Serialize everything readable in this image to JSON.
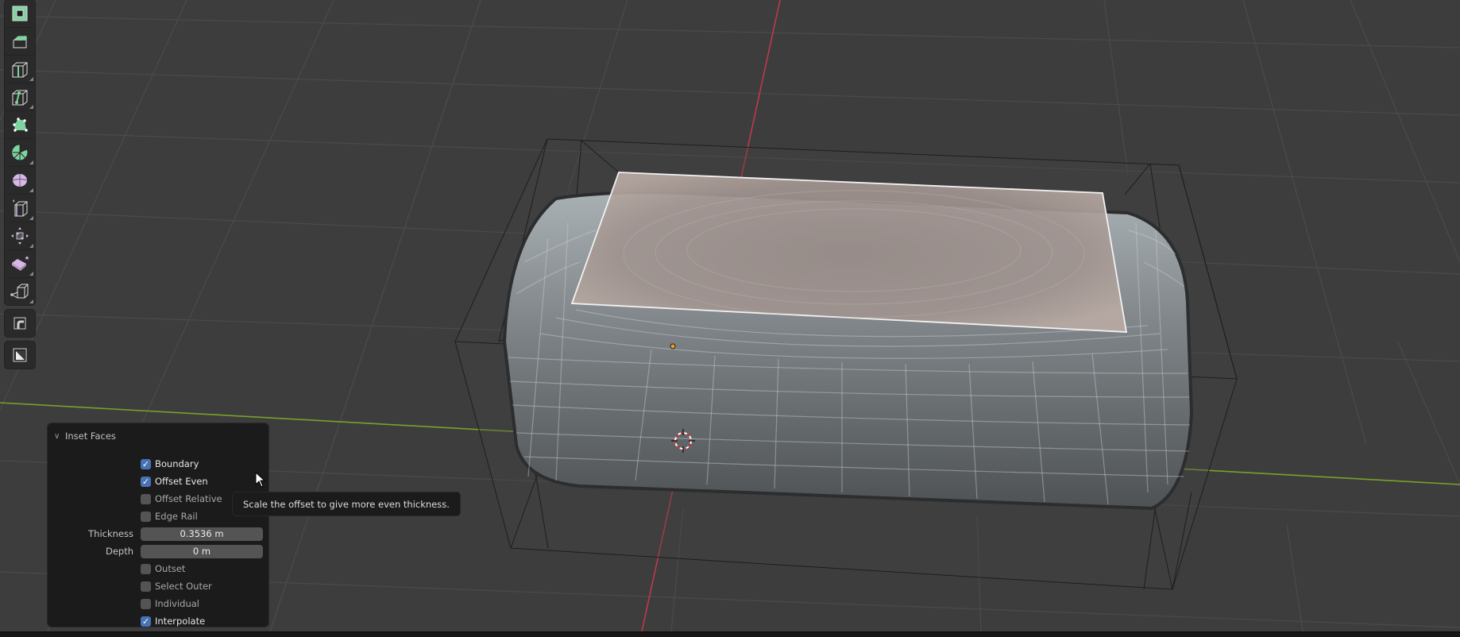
{
  "app": "Blender",
  "viewport": {
    "mode": "Edit Mode",
    "background_color": "#3d3d3d",
    "axis_colors": {
      "x": "#c0394b",
      "y": "#7aa02a"
    },
    "selected_face_color": "#b59e94",
    "origin_color": "#f09a20"
  },
  "toolbar": {
    "groups": [
      [
        {
          "icon": "select-box-icon",
          "label": "Select Box",
          "active": true
        },
        {
          "icon": "extrude-region-icon",
          "label": "Extrude Region"
        },
        {
          "icon": "loop-cut-icon",
          "label": "Loop Cut"
        },
        {
          "icon": "knife-icon",
          "label": "Knife"
        },
        {
          "icon": "poly-build-icon",
          "label": "Poly Build"
        },
        {
          "icon": "spin-icon",
          "label": "Spin"
        },
        {
          "icon": "smooth-icon",
          "label": "Smooth"
        },
        {
          "icon": "edge-slide-icon",
          "label": "Edge Slide"
        },
        {
          "icon": "shrink-fatten-icon",
          "label": "Shrink/Fatten"
        },
        {
          "icon": "shear-icon",
          "label": "Shear"
        },
        {
          "icon": "rip-region-icon",
          "label": "Rip Region"
        }
      ],
      [
        {
          "icon": "annotate-icon",
          "label": "Annotate"
        }
      ],
      [
        {
          "icon": "measure-icon",
          "label": "Measure"
        }
      ]
    ]
  },
  "operator_panel": {
    "title": "Inset Faces",
    "options": [
      {
        "label": "Boundary",
        "checked": true
      },
      {
        "label": "Offset Even",
        "checked": true
      },
      {
        "label": "Offset Relative",
        "checked": false
      },
      {
        "label": "Edge Rail",
        "checked": false
      }
    ],
    "fields": [
      {
        "label": "Thickness",
        "value": "0.3536 m"
      },
      {
        "label": "Depth",
        "value": "0 m"
      }
    ],
    "options2": [
      {
        "label": "Outset",
        "checked": false
      },
      {
        "label": "Select Outer",
        "checked": false
      },
      {
        "label": "Individual",
        "checked": false
      },
      {
        "label": "Interpolate",
        "checked": true
      }
    ]
  },
  "tooltip": {
    "text": "Scale the offset to give more even thickness."
  }
}
